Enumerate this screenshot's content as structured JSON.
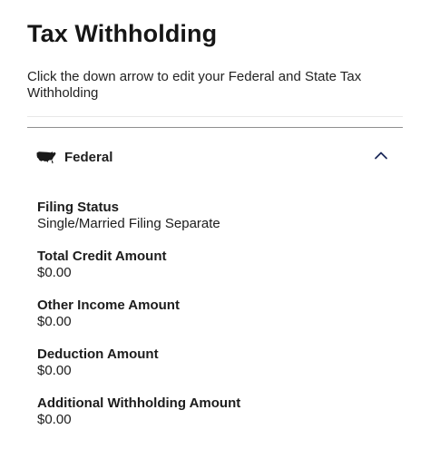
{
  "page": {
    "title": "Tax Withholding",
    "instructions": "Click the down arrow to edit your Federal and State Tax Withholding"
  },
  "federal": {
    "title": "Federal",
    "icon": "us-map-icon",
    "chevron_icon": "chevron-up-icon",
    "expanded": true,
    "fields": [
      {
        "label": "Filing Status",
        "value": "Single/Married Filing Separate"
      },
      {
        "label": "Total Credit Amount",
        "value": "$0.00"
      },
      {
        "label": "Other Income Amount",
        "value": "$0.00"
      },
      {
        "label": "Deduction Amount",
        "value": "$0.00"
      },
      {
        "label": "Additional Withholding Amount",
        "value": "$0.00"
      }
    ]
  },
  "colors": {
    "text": "#1c1c1c",
    "accent": "#1d2a5a",
    "divider": "#8f8f8f"
  }
}
